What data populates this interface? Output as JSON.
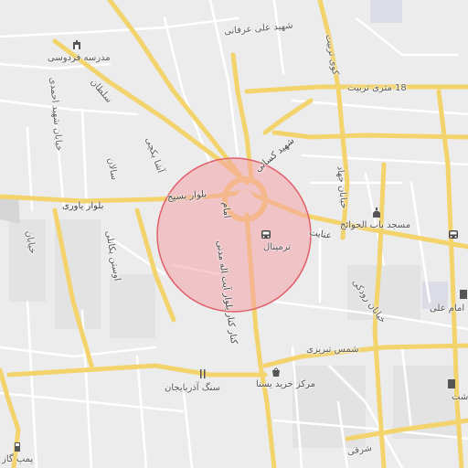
{
  "map": {
    "highlight": {
      "fill": "#f4a3a8",
      "stroke": "#e0606a"
    },
    "colors": {
      "major_road": "#f3d36b",
      "minor_road": "#ffffff",
      "background": "#ececec",
      "block": "#e2e2e2",
      "park": "#d8d8de"
    },
    "labels": {
      "street_erfani": "شهید علی عرفانی",
      "street_kooy": "کوی تربیت",
      "street_tarbiat": "18 متری تربیت",
      "street_soltan": "سلطان",
      "street_ahamdi": "خیابان شهید احمدی",
      "street_bichi": "آشا یکچی",
      "street_basij": "بلوار بسیج",
      "street_yavari": "بلوار یاوری",
      "street_salan": "سالان",
      "street_ostad": "اوستن یکانلی",
      "street_emam_ahmad": "کنار کنار بلوار آیت اله مدنی",
      "street_kasaei": "شهید کسائی",
      "street_enayat": "عنایت",
      "street_jahad": "خیابان جهاد",
      "street_roodaki": "خیابان رودکی",
      "street_shams": "شمس تبریزی",
      "street_sharghi": "شرقی",
      "street_emam": "امام",
      "street_left": "خیابان",
      "poi_school": "مدرسه فردوسی",
      "poi_terminal": "ترمینال",
      "poi_mosque": "مسجد باب الحوائج",
      "poi_shopping": "مرکز خرید یسنا",
      "poi_sang": "سنگ آذربایجان",
      "poi_emam_ali": "امام علی",
      "poi_gas": "پمپ گاز",
      "poi_edge_right": "شت"
    },
    "icons": [
      "school-icon",
      "bus-icon",
      "mosque-icon",
      "shopping-icon",
      "restaurant-icon",
      "gas-station-icon",
      "building-icon"
    ]
  }
}
